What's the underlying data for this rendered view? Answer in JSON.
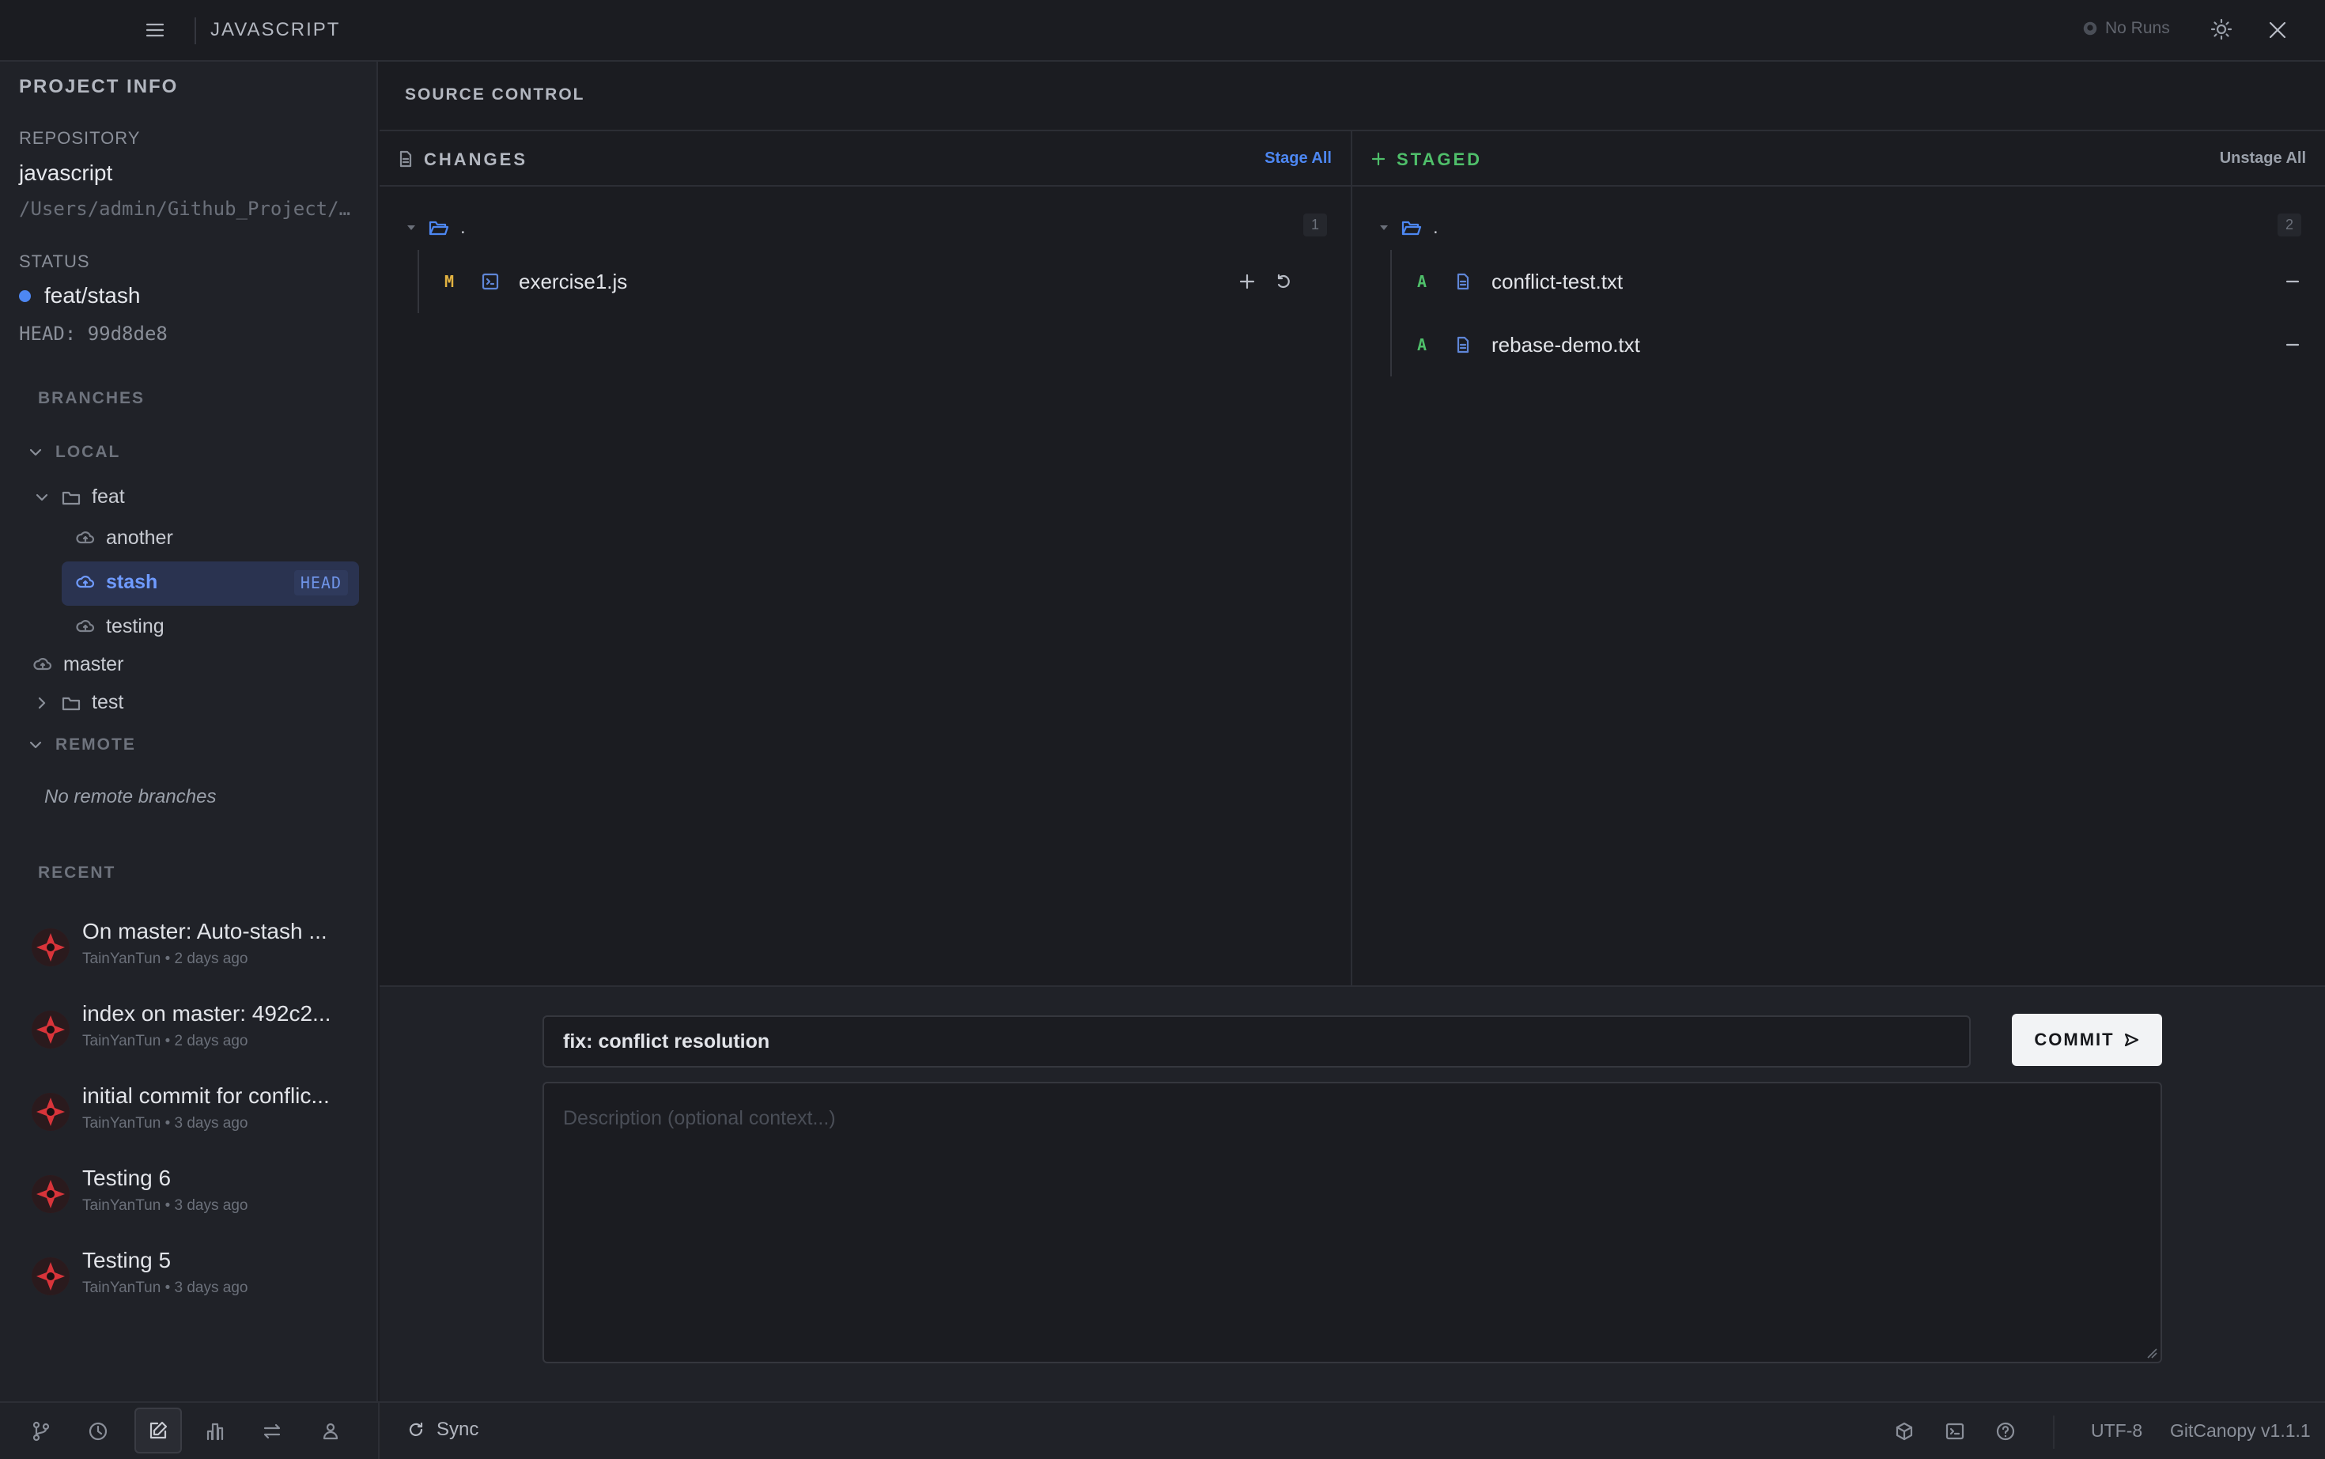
{
  "header": {
    "title": "JAVASCRIPT",
    "runs_label": "No Runs"
  },
  "sidebar": {
    "section_title": "PROJECT INFO",
    "repository_label": "REPOSITORY",
    "repository_name": "javascript",
    "repository_path": "/Users/admin/Github_Project/…",
    "status_label": "STATUS",
    "current_branch": "feat/stash",
    "head_sha": "HEAD: 99d8de8",
    "branches_title": "BRANCHES",
    "local_label": "LOCAL",
    "local_tree": {
      "feat_folder": "feat",
      "feat_children": [
        "another",
        "stash",
        "testing"
      ],
      "selected_branch": "stash",
      "head_badge": "HEAD",
      "master": "master",
      "test_folder": "test"
    },
    "remote_label": "REMOTE",
    "remote_empty": "No remote branches",
    "recent_title": "RECENT",
    "recent": [
      {
        "title": "On master: Auto-stash ...",
        "author": "TainYanTun",
        "time": "2 days ago"
      },
      {
        "title": "index on master: 492c2...",
        "author": "TainYanTun",
        "time": "2 days ago"
      },
      {
        "title": "initial commit for conflic...",
        "author": "TainYanTun",
        "time": "3 days ago"
      },
      {
        "title": "Testing 6",
        "author": "TainYanTun",
        "time": "3 days ago"
      },
      {
        "title": "Testing 5",
        "author": "TainYanTun",
        "time": "3 days ago"
      }
    ],
    "meta_separator": "•"
  },
  "source_control": {
    "title": "SOURCE CONTROL",
    "changes": {
      "title": "CHANGES",
      "action": "Stage All",
      "dir": ".",
      "count": "1",
      "files": [
        {
          "status": "M",
          "name": "exercise1.js"
        }
      ]
    },
    "staged": {
      "title": "STAGED",
      "action": "Unstage All",
      "dir": ".",
      "count": "2",
      "files": [
        {
          "status": "A",
          "name": "conflict-test.txt"
        },
        {
          "status": "A",
          "name": "rebase-demo.txt"
        }
      ]
    },
    "commit_message": "fix: conflict resolution",
    "commit_button": "COMMIT",
    "description_placeholder": "Description (optional context...)"
  },
  "footer": {
    "sync_label": "Sync",
    "encoding": "UTF-8",
    "version": "GitCanopy v1.1.1"
  },
  "colors": {
    "accent_blue": "#4d87f2",
    "modified_yellow": "#e3b341",
    "added_green": "#4fbf6a",
    "background": "#1b1c21",
    "sidebar": "#202228"
  }
}
